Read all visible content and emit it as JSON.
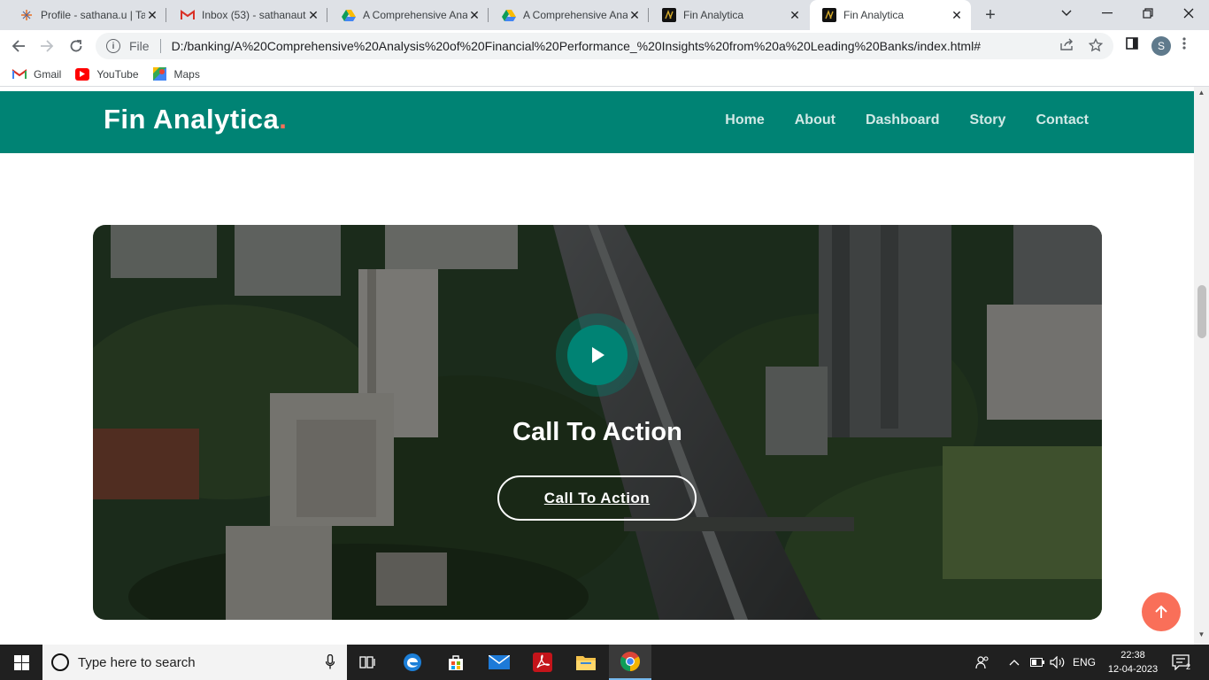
{
  "browser": {
    "tabs": [
      {
        "title": "Profile - sathana.u | Ta",
        "icon": "tableau-icon",
        "active": false
      },
      {
        "title": "Inbox (53) - sathanaut",
        "icon": "gmail-icon",
        "active": false
      },
      {
        "title": "A Comprehensive Ana",
        "icon": "google-drive-icon",
        "active": false
      },
      {
        "title": "A Comprehensive Ana",
        "icon": "google-drive-icon",
        "active": false
      },
      {
        "title": "Fin Analytica",
        "icon": "fin-analytica-favicon",
        "active": false
      },
      {
        "title": "Fin Analytica",
        "icon": "fin-analytica-favicon",
        "active": true
      }
    ],
    "omnibox": {
      "scheme_label": "File",
      "url": "D:/banking/A%20Comprehensive%20Analysis%20of%20Financial%20Performance_%20Insights%20from%20a%20Leading%20Banks/index.html#"
    },
    "profile_initial": "S",
    "bookmarks": [
      {
        "label": "Gmail",
        "icon": "gmail-icon"
      },
      {
        "label": "YouTube",
        "icon": "youtube-icon"
      },
      {
        "label": "Maps",
        "icon": "maps-icon"
      }
    ]
  },
  "site": {
    "logo_text": "Fin Analytica",
    "logo_dot": ".",
    "nav": [
      "Home",
      "About",
      "Dashboard",
      "Story",
      "Contact"
    ],
    "cta": {
      "title": "Call To Action",
      "button_label": "Call To Action"
    },
    "colors": {
      "brand": "#008374",
      "accent": "#f96f59"
    }
  },
  "taskbar": {
    "search_placeholder": "Type here to search",
    "language": "ENG",
    "time": "22:38",
    "date": "12-04-2023",
    "notification_count": "2"
  }
}
